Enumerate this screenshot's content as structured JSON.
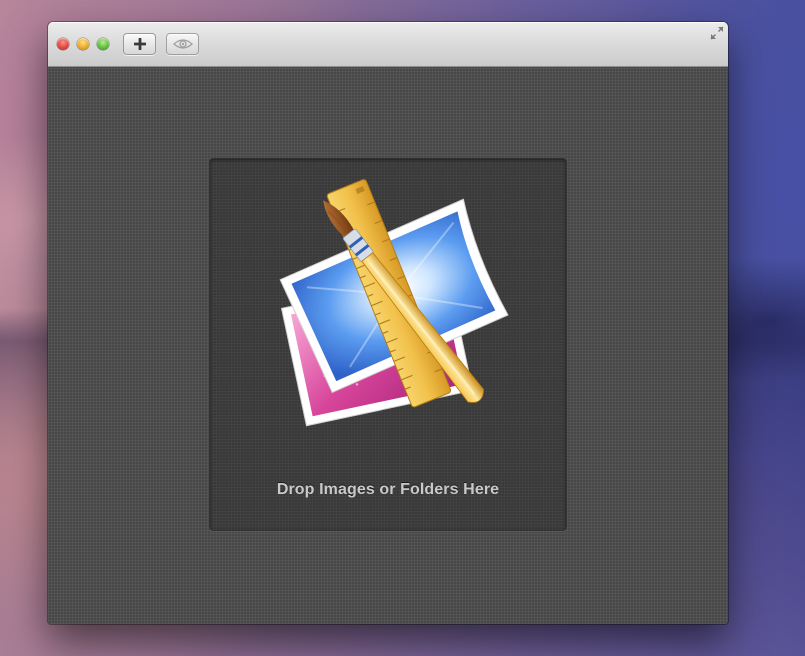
{
  "window": {
    "toolbar": {
      "add_button_icon": "plus-icon",
      "preview_button_icon": "eye-icon",
      "fullscreen_icon": "fullscreen-arrows-icon"
    },
    "drop_zone": {
      "icon": "app-icon-ruler-brush-photos",
      "label": "Drop Images or Folders Here"
    }
  },
  "colors": {
    "content_background": "#4e4e4e",
    "drop_zone_background": "#3d3d3d",
    "label_text": "#c9c9c9"
  }
}
